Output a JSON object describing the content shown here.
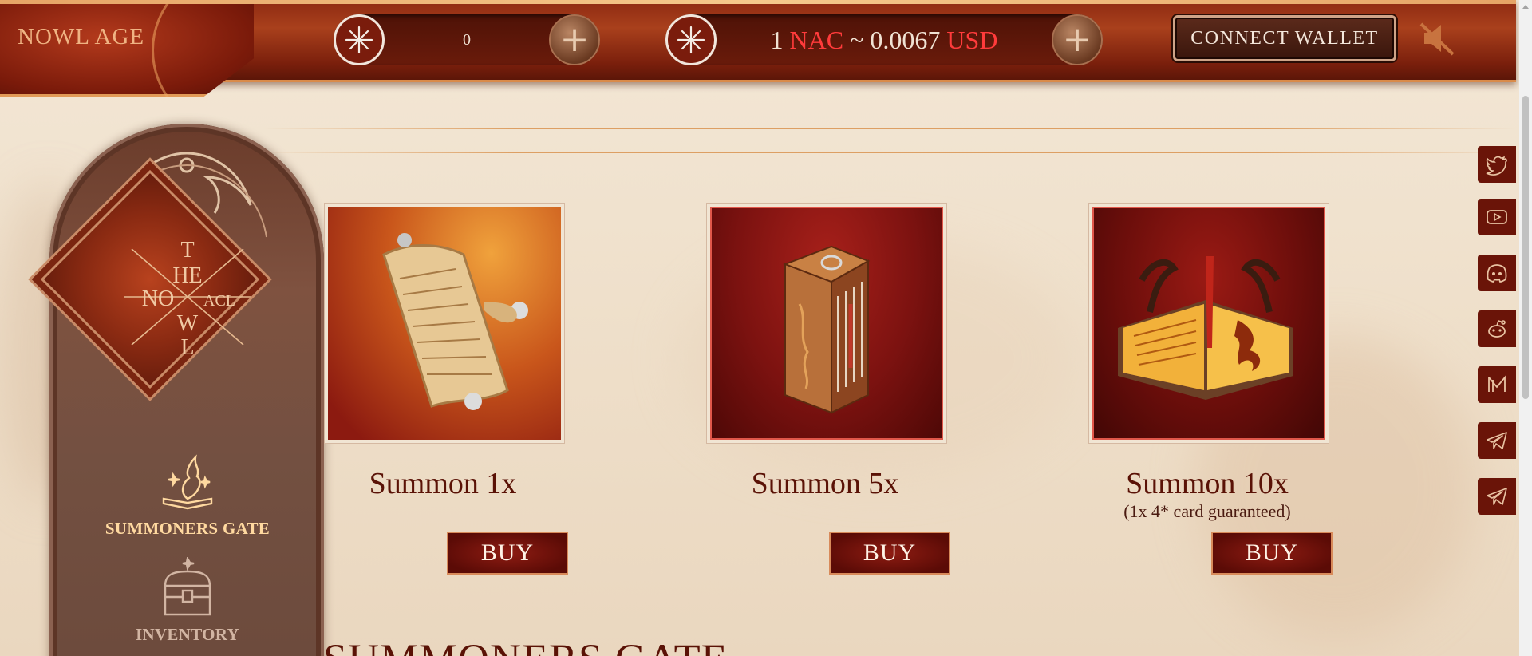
{
  "header": {
    "logo": "NOWL AGE",
    "token_balance": "0",
    "rate": {
      "amount": "1",
      "token": "NAC",
      "sep": "~",
      "usd_value": "0.0067",
      "currency": "USD"
    },
    "connect_label": "CONNECT WALLET"
  },
  "sidebar": {
    "emblem": {
      "t": "T",
      "he": "HE",
      "no": "NO",
      "acl": "ACL",
      "w": "W",
      "l": "L"
    },
    "items": [
      {
        "label": "SUMMONERS GATE",
        "icon": "magic-book-icon",
        "active": true
      },
      {
        "label": "INVENTORY",
        "icon": "treasure-chest-icon",
        "active": false
      }
    ]
  },
  "cards": [
    {
      "title": "Summon 1x",
      "subtitle": "",
      "buy": "BUY",
      "art": "scroll-art"
    },
    {
      "title": "Summon 5x",
      "subtitle": "",
      "buy": "BUY",
      "art": "book-stack-art"
    },
    {
      "title": "Summon 10x",
      "subtitle": "(1x 4* card guaranteed)",
      "buy": "BUY",
      "art": "open-grimoire-art"
    }
  ],
  "section_heading": "SUMMONERS GATE",
  "social": [
    "twitter-icon",
    "youtube-icon",
    "discord-icon",
    "reddit-icon",
    "medium-icon",
    "telegram-icon",
    "telegram-icon"
  ],
  "colors": {
    "accent_red": "#ff3b3b",
    "dark_red": "#5a1206",
    "gold": "#ffd9a0"
  }
}
